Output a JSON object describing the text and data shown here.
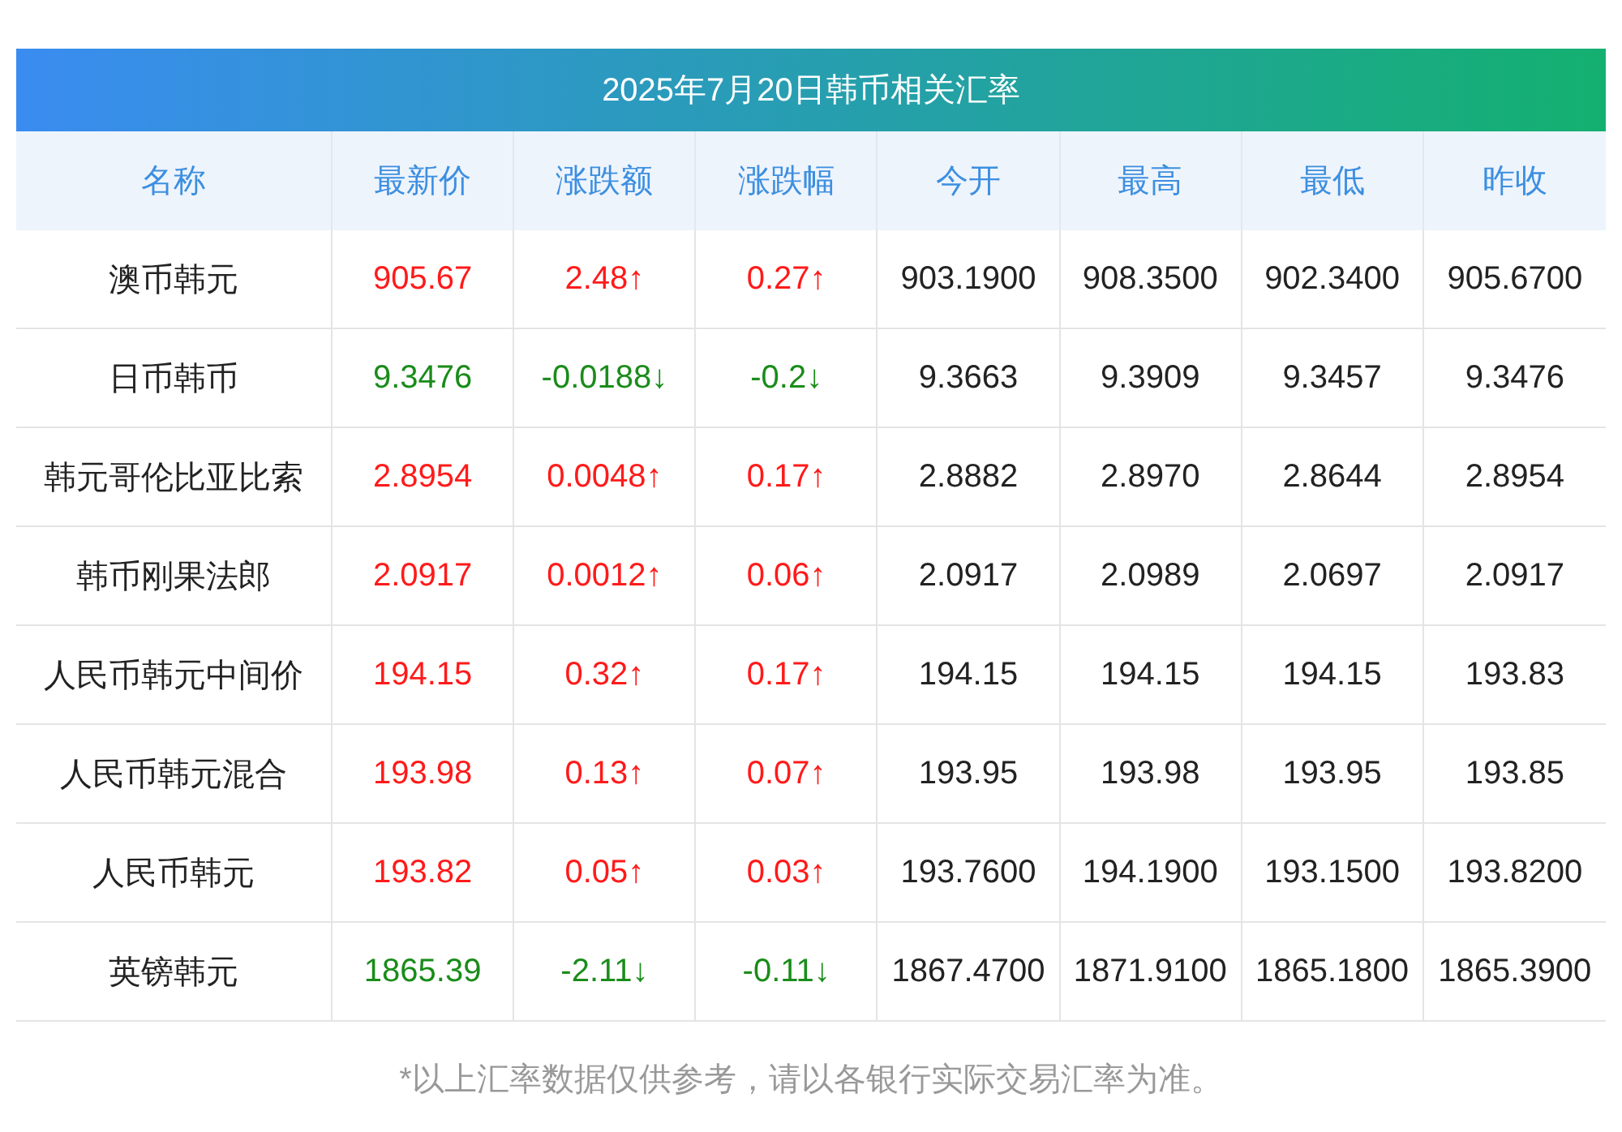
{
  "title": "2025年7月20日韩币相关汇率",
  "columns": [
    "名称",
    "最新价",
    "涨跌额",
    "涨跌幅",
    "今开",
    "最高",
    "最低",
    "昨收"
  ],
  "rows": [
    {
      "rising": true,
      "cells": [
        "澳币韩元",
        "905.67",
        "2.48↑",
        "0.27↑",
        "903.1900",
        "908.3500",
        "902.3400",
        "905.6700"
      ]
    },
    {
      "rising": false,
      "cells": [
        "日币韩币",
        "9.3476",
        "-0.0188↓",
        "-0.2↓",
        "9.3663",
        "9.3909",
        "9.3457",
        "9.3476"
      ]
    },
    {
      "rising": true,
      "cells": [
        "韩元哥伦比亚比索",
        "2.8954",
        "0.0048↑",
        "0.17↑",
        "2.8882",
        "2.8970",
        "2.8644",
        "2.8954"
      ]
    },
    {
      "rising": true,
      "cells": [
        "韩币刚果法郎",
        "2.0917",
        "0.0012↑",
        "0.06↑",
        "2.0917",
        "2.0989",
        "2.0697",
        "2.0917"
      ]
    },
    {
      "rising": true,
      "cells": [
        "人民币韩元中间价",
        "194.15",
        "0.32↑",
        "0.17↑",
        "194.15",
        "194.15",
        "194.15",
        "193.83"
      ]
    },
    {
      "rising": true,
      "cells": [
        "人民币韩元混合",
        "193.98",
        "0.13↑",
        "0.07↑",
        "193.95",
        "193.98",
        "193.95",
        "193.85"
      ]
    },
    {
      "rising": true,
      "cells": [
        "人民币韩元",
        "193.82",
        "0.05↑",
        "0.03↑",
        "193.7600",
        "194.1900",
        "193.1500",
        "193.8200"
      ]
    },
    {
      "rising": false,
      "cells": [
        "英镑韩元",
        "1865.39",
        "-2.11↓",
        "-0.11↓",
        "1867.4700",
        "1871.9100",
        "1865.1800",
        "1865.3900"
      ]
    }
  ],
  "footnote": "*以上汇率数据仅供参考，请以各银行实际交易汇率为准。"
}
